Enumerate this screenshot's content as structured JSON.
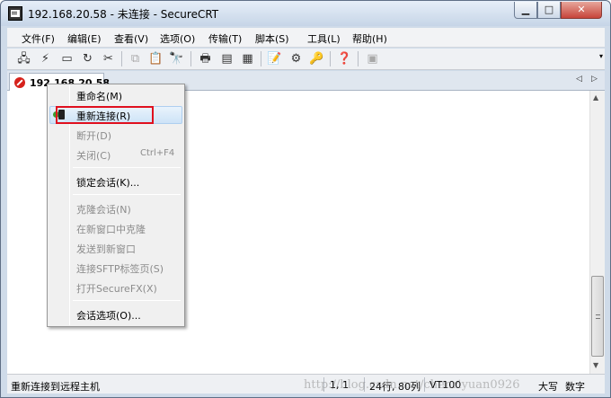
{
  "window": {
    "title": "192.168.20.58 - 未连接 - SecureCRT",
    "controls": {
      "minimize": "▁",
      "maximize": "□",
      "close": "✕"
    }
  },
  "menubar": {
    "items": [
      "文件(F)",
      "编辑(E)",
      "查看(V)",
      "选项(O)",
      "传输(T)",
      "脚本(S)",
      "工具(L)",
      "帮助(H)"
    ]
  },
  "toolbar": {
    "icons": [
      "connect-icon",
      "quick-connect-icon",
      "connect-in-tab-icon",
      "reconnect-icon",
      "disconnect-icon",
      "copy-icon",
      "paste-icon",
      "find-icon",
      "print-icon",
      "print-selection-icon",
      "print-setup-icon",
      "session-options-icon",
      "global-options-icon",
      "key-icon",
      "help-icon",
      "keymap-icon"
    ],
    "overflow": "▾"
  },
  "tabs": {
    "items": [
      {
        "label": "192.168.20.58",
        "status": "disconnected"
      }
    ],
    "prev": "◁",
    "next": "▷"
  },
  "context_menu": {
    "items": [
      {
        "label": "重命名(M)",
        "enabled": true
      },
      {
        "label": "重新连接(R)",
        "enabled": true,
        "highlighted": true
      },
      {
        "label": "断开(D)",
        "enabled": false
      },
      {
        "label": "关闭(C)",
        "shortcut": "Ctrl+F4",
        "enabled": false
      },
      {
        "label": "锁定会话(K)...",
        "enabled": true
      },
      {
        "label": "克隆会话(N)",
        "enabled": false
      },
      {
        "label": "在新窗口中克隆",
        "enabled": false
      },
      {
        "label": "发送到新窗口",
        "enabled": false
      },
      {
        "label": "连接SFTP标签页(S)",
        "enabled": false
      },
      {
        "label": "打开SecureFX(X)",
        "enabled": false
      },
      {
        "label": "会话选项(O)...",
        "enabled": true
      }
    ]
  },
  "statusbar": {
    "message": "重新连接到远程主机",
    "position": "1,   1",
    "dimensions": "24行, 80列",
    "terminal": "VT100",
    "caps": "大写",
    "num": "数字",
    "watermark": "http://blog.csdn.net/chenriyuan0926"
  },
  "colors": {
    "title_gradient": "#c6d5e7",
    "close_button": "#c7443a",
    "highlight_box": "#e0101e",
    "menu_highlight": "#cde3f7",
    "disabled_text": "#8c8c8c"
  }
}
